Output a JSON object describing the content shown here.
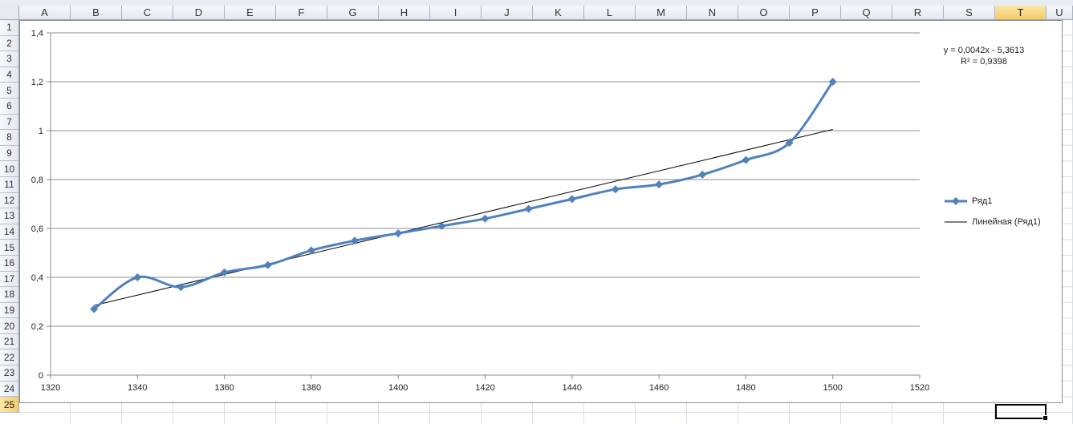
{
  "sheet": {
    "columns": [
      "A",
      "B",
      "C",
      "D",
      "E",
      "F",
      "G",
      "H",
      "I",
      "J",
      "K",
      "L",
      "M",
      "N",
      "O",
      "P",
      "Q",
      "R",
      "S",
      "T",
      "U"
    ],
    "active_column": "T",
    "rows": [
      "1",
      "2",
      "3",
      "4",
      "5",
      "6",
      "7",
      "8",
      "9",
      "10",
      "11",
      "12",
      "13",
      "14",
      "15",
      "16",
      "17",
      "18",
      "19",
      "20",
      "21",
      "22",
      "23",
      "24",
      "25"
    ],
    "active_row": "25"
  },
  "colors": {
    "series": "#4f81bd",
    "trendline": "#000000",
    "gridline": "#8c8c8c"
  },
  "chart_data": {
    "type": "line",
    "x": [
      1330,
      1340,
      1350,
      1360,
      1370,
      1380,
      1390,
      1400,
      1410,
      1420,
      1430,
      1440,
      1450,
      1460,
      1470,
      1480,
      1490,
      1500
    ],
    "series": [
      {
        "name": "Ряд1",
        "marker": "diamond",
        "smooth": true,
        "values": [
          0.27,
          0.4,
          0.36,
          0.42,
          0.45,
          0.51,
          0.55,
          0.58,
          0.61,
          0.64,
          0.68,
          0.72,
          0.76,
          0.78,
          0.82,
          0.88,
          0.95,
          1.2
        ]
      }
    ],
    "trendline": {
      "name": "Линейная (Ряд1)",
      "type": "linear",
      "slope": 0.0042,
      "intercept": -5.3613,
      "x_start": 1330,
      "x_end": 1500,
      "y_start": 0.285,
      "y_end": 1.005,
      "equation": "y = 0,0042x - 5,3613",
      "r_squared": "R² = 0,9398"
    },
    "xlim": [
      1320,
      1520
    ],
    "ylim": [
      0,
      1.4
    ],
    "xticks": [
      "1320",
      "1340",
      "1360",
      "1380",
      "1400",
      "1420",
      "1440",
      "1460",
      "1480",
      "1500",
      "1520"
    ],
    "xtick_values": [
      1320,
      1340,
      1360,
      1380,
      1400,
      1420,
      1440,
      1460,
      1480,
      1500,
      1520
    ],
    "yticks": [
      "0",
      "0,2",
      "0,4",
      "0,6",
      "0,8",
      "1",
      "1,2",
      "1,4"
    ],
    "ytick_values": [
      0,
      0.2,
      0.4,
      0.6,
      0.8,
      1.0,
      1.2,
      1.4
    ],
    "grid": "horizontal",
    "legend_position": "right"
  }
}
